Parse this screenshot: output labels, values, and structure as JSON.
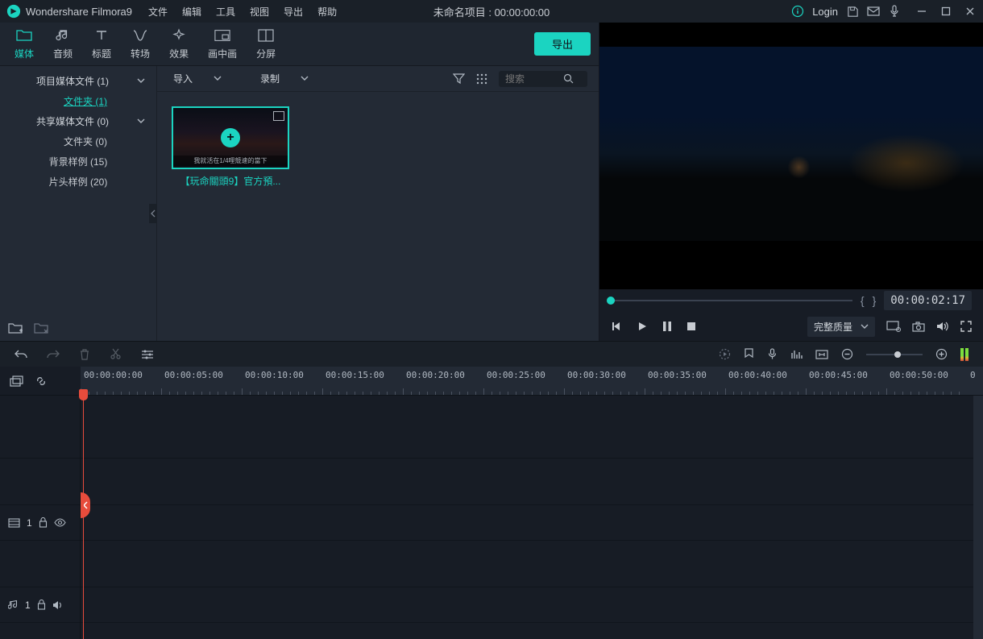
{
  "app": {
    "title": "Wondershare Filmora9"
  },
  "menu": [
    "文件",
    "编辑",
    "工具",
    "视图",
    "导出",
    "帮助"
  ],
  "project": {
    "title": "未命名项目 : 00:00:00:00"
  },
  "titlebar": {
    "login": "Login"
  },
  "tabs": [
    {
      "label": "媒体",
      "active": true
    },
    {
      "label": "音频"
    },
    {
      "label": "标题"
    },
    {
      "label": "转场"
    },
    {
      "label": "效果"
    },
    {
      "label": "画中画"
    },
    {
      "label": "分屏"
    }
  ],
  "export_label": "导出",
  "tree": {
    "items": [
      {
        "label": "项目媒体文件 (1)",
        "expandable": true
      },
      {
        "label": "文件夹 (1)",
        "active": true,
        "indented": true
      },
      {
        "label": "共享媒体文件 (0)",
        "expandable": true
      },
      {
        "label": "文件夹 (0)",
        "indented": true
      },
      {
        "label": "背景样例 (15)"
      },
      {
        "label": "片头样例 (20)"
      }
    ]
  },
  "media_toolbar": {
    "import": "导入",
    "record": "录制",
    "search_placeholder": "搜索"
  },
  "clip": {
    "label": "【玩命關頭9】官方預...",
    "caption": "我就活在1/4哩競速的當下"
  },
  "preview": {
    "timecode": "00:00:02:17",
    "quality_label": "完整质量"
  },
  "timeline": {
    "marks": [
      "00:00:00:00",
      "00:00:05:00",
      "00:00:10:00",
      "00:00:15:00",
      "00:00:20:00",
      "00:00:25:00",
      "00:00:30:00",
      "00:00:35:00",
      "00:00:40:00",
      "00:00:45:00",
      "00:00:50:00"
    ],
    "end_label": "0",
    "video_track": "1",
    "audio_track": "1"
  }
}
